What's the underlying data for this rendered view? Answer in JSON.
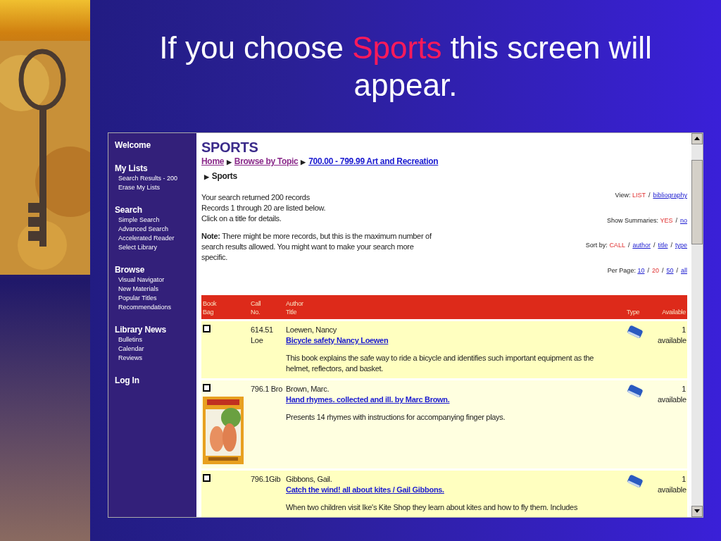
{
  "slide_title": [
    {
      "text": "If you choose ",
      "highlight": false
    },
    {
      "text": "Sports",
      "highlight": true
    },
    {
      "text": " this screen will appear.",
      "highlight": false
    }
  ],
  "sidebar": [
    {
      "heading": "Welcome"
    },
    {
      "heading": "My Lists",
      "items": [
        "Search Results - 200",
        "Erase My Lists"
      ]
    },
    {
      "heading": "Search",
      "items": [
        "Simple Search",
        "Advanced Search",
        "Accelerated Reader",
        "Select Library"
      ]
    },
    {
      "heading": "Browse",
      "items": [
        "Visual Navigator",
        "New Materials",
        "Popular Titles",
        "Recommendations"
      ]
    },
    {
      "heading": "Library News",
      "items": [
        "Bulletins",
        "Calendar",
        "Reviews"
      ]
    },
    {
      "heading": "Log In"
    }
  ],
  "page_title": "SPORTS",
  "breadcrumb": [
    {
      "text": "Home",
      "visited": true
    },
    {
      "marker": "▶",
      "text": "Browse by Topic",
      "visited": true
    },
    {
      "marker": "▶",
      "text": "700.00 - 799.99 Art and Recreation",
      "visited": false
    }
  ],
  "current": {
    "marker": "▶",
    "text": "Sports"
  },
  "summary": [
    "Your search returned 200 records",
    "Records 1 through 20 are listed below.",
    "Click on a title for details."
  ],
  "note": "**Note:** There might be more records, but this is the maximum number of search results allowed. You might want to make your search more specific.",
  "options": [
    {
      "label": "View:",
      "choices": [
        {
          "text": "LIST",
          "selected": true
        },
        {
          "sep": "/",
          "text": "bibliography",
          "selected": false
        }
      ]
    },
    {
      "label": "Show Summaries:",
      "choices": [
        {
          "text": "YES",
          "selected": true
        },
        {
          "sep": "/",
          "text": "no",
          "selected": false
        }
      ]
    },
    {
      "label": "Sort by:",
      "choices": [
        {
          "text": "CALL",
          "selected": true
        },
        {
          "sep": "/",
          "text": "author",
          "selected": false
        },
        {
          "sep": "/",
          "text": "title",
          "selected": false
        },
        {
          "sep": "/",
          "text": "type",
          "selected": false
        }
      ]
    },
    {
      "label": "Per Page:",
      "choices": [
        {
          "text": "10",
          "selected": false
        },
        {
          "sep": "/",
          "text": "20",
          "selected": true
        },
        {
          "sep": "/",
          "text": "50",
          "selected": false
        },
        {
          "sep": "/",
          "text": "all",
          "selected": false
        }
      ]
    }
  ],
  "columns": [
    "Book Bag",
    "Call No.",
    "Author Title",
    "Type",
    "Available"
  ],
  "rows": [
    {
      "checked": false,
      "call": "614.51 Loe",
      "author": "Loewen, Nancy",
      "title": "Bicycle safety Nancy Loewen",
      "description": "This book explains the safe way to ride a bicycle and identifies such important equipment as the helmet, reflectors, and basket.",
      "cover": false,
      "available": "1 available"
    },
    {
      "checked": false,
      "call": "796.1 Bro",
      "author": "Brown, Marc.",
      "title": "Hand rhymes. collected and ill. by Marc Brown.",
      "description": "Presents 14 rhymes with instructions for accompanying finger plays.",
      "cover": true,
      "available": "1 available"
    },
    {
      "checked": false,
      "call": "796.1Gib",
      "author": "Gibbons, Gail.",
      "title": "Catch the wind! all about kites / Gail Gibbons.",
      "description": "When two children visit Ike's Kite Shop they learn about kites and how to fly them. Includes",
      "cover": false,
      "available": "1 available"
    }
  ]
}
